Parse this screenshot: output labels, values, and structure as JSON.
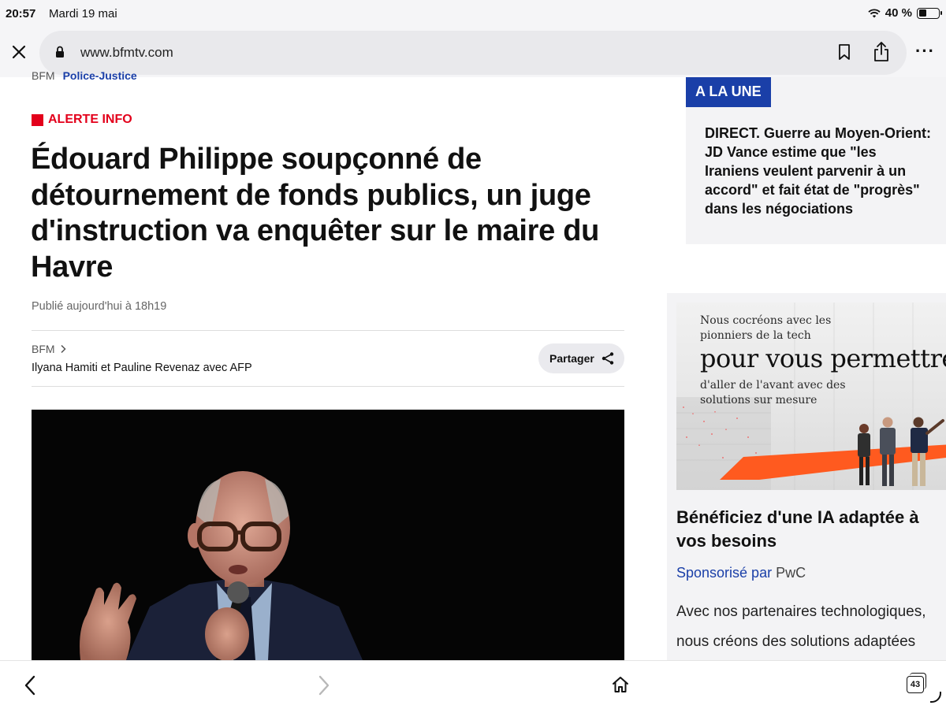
{
  "status_bar": {
    "time": "20:57",
    "date": "Mardi 19 mai",
    "battery": "40 %",
    "battery_level": 0.4
  },
  "browser": {
    "url": "www.bfmtv.com",
    "icons": [
      "close-icon",
      "lock-icon",
      "bookmark-icon",
      "share-icon",
      "more-icon"
    ]
  },
  "article": {
    "breadcrumb_home": "BFM",
    "breadcrumb_section": "Police-Justice",
    "alert_label": "ALERTE INFO",
    "headline": "Édouard Philippe soupçonné de détournement de fonds publics, un juge d'instruction va enquêter sur le maire du Havre",
    "published": "Publié aujourd'hui à 18h19",
    "source": "BFM",
    "authors": "Ilyana Hamiti et Pauline Revenaz avec AFP",
    "share_label": "Partager"
  },
  "sidebar": {
    "a_la_une_label": "A LA UNE",
    "a_la_une_lines": [
      "DIRECT. Guerre au Moyen-Orient:",
      "JD Vance estime que \"les",
      "Iraniens veulent parvenir à un",
      "accord\" et fait état de \"progrès\"",
      "dans les négociations"
    ],
    "ad": {
      "small_line1": "Nous cocréons avec les",
      "small_line2": "pionniers de la tech",
      "big_line": "pour vous permettre",
      "small_line3": "d'aller de l'avant avec des",
      "small_line4": "solutions sur mesure",
      "title_line1": "Bénéficiez d'une IA adaptée à",
      "title_line2": "vos besoins",
      "sponsored_label": "Sponsorisé par",
      "sponsor": "PwC",
      "body_line1": "Avec nos partenaires technologiques,",
      "body_line2": "nous créons des solutions adaptées"
    }
  },
  "toolbar": {
    "tab_count": "43",
    "icons": [
      "back-icon",
      "forward-icon",
      "home-icon",
      "tabs-icon"
    ]
  },
  "colors": {
    "brand_blue": "#1a3fa8",
    "alert_red": "#e3001b",
    "ad_orange": "#ff5a1f"
  }
}
